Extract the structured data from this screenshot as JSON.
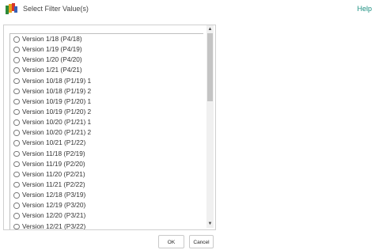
{
  "header": {
    "title": "Select Filter Value(s)",
    "help_label": "Help",
    "app_icon": "app-logo-icon"
  },
  "list": {
    "items": [
      "Version 1/18 (P4/18)",
      "Version 1/19 (P4/19)",
      "Version 1/20 (P4/20)",
      "Version 1/21 (P4/21)",
      "Version 10/18 (P1/19) 1",
      "Version 10/18 (P1/19) 2",
      "Version 10/19 (P1/20) 1",
      "Version 10/19 (P1/20) 2",
      "Version 10/20 (P1/21) 1",
      "Version 10/20 (P1/21) 2",
      "Version 10/21 (P1/22)",
      "Version 11/18 (P2/19)",
      "Version 11/19 (P2/20)",
      "Version 11/20 (P2/21)",
      "Version 11/21 (P2/22)",
      "Version 12/18 (P3/19)",
      "Version 12/19 (P3/20)",
      "Version 12/20 (P3/21)",
      "Version 12/21 (P3/22)"
    ]
  },
  "buttons": {
    "ok_label": "OK",
    "cancel_label": "Cancel"
  },
  "colors": {
    "help_link": "#1a8f80",
    "border": "#cfcfcf",
    "scroll_thumb": "#c4c4c4"
  }
}
